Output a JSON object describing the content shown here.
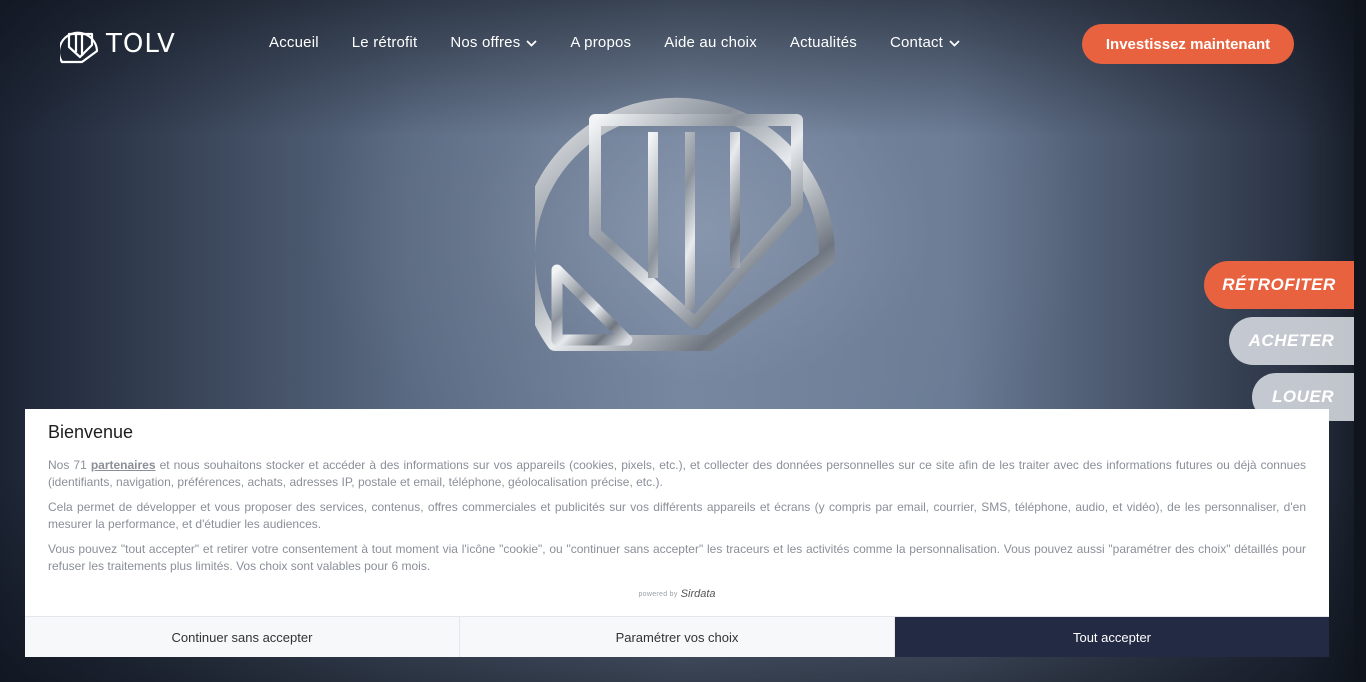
{
  "brand": {
    "name": "TOLV"
  },
  "nav": {
    "items": [
      {
        "label": "Accueil",
        "dropdown": false
      },
      {
        "label": "Le rétrofit",
        "dropdown": false
      },
      {
        "label": "Nos offres",
        "dropdown": true
      },
      {
        "label": "A propos",
        "dropdown": false
      },
      {
        "label": "Aide au choix",
        "dropdown": false
      },
      {
        "label": "Actualités",
        "dropdown": false
      },
      {
        "label": "Contact",
        "dropdown": true
      }
    ],
    "cta_label": "Investissez maintenant"
  },
  "side_tabs": {
    "retrofit": "RÉTROFITER",
    "buy": "ACHETER",
    "rent": "LOUER"
  },
  "cookie": {
    "title": "Bienvenue",
    "p1_prefix": "Nos 71 ",
    "p1_link": "partenaires",
    "p1_suffix": " et nous souhaitons stocker et accéder à des informations sur vos appareils (cookies, pixels, etc.), et collecter des données personnelles sur ce site afin de les traiter avec des informations futures ou déjà connues (identifiants, navigation, préférences, achats, adresses IP, postale et email, téléphone, géolocalisation précise, etc.).",
    "p2": "Cela permet de développer et vous proposer des services, contenus, offres commerciales et publicités sur vos différents appareils et écrans (y compris par email, courrier, SMS, téléphone, audio, et vidéo), de les personnaliser, d'en mesurer la performance, et d'étudier les audiences.",
    "p3": "Vous pouvez \"tout accepter\" et retirer votre consentement à tout moment via l'icône \"cookie\", ou \"continuer sans accepter\" les traceurs et les activités comme la personnalisation. Vous pouvez aussi \"paramétrer des choix\" détaillés pour refuser les traitements plus limités. Vos choix sont valables pour 6 mois.",
    "powered_by": "powered by",
    "powered_brand": "Sirdata",
    "buttons": {
      "continue": "Continuer sans accepter",
      "settings": "Paramétrer vos choix",
      "accept": "Tout accepter"
    }
  },
  "colors": {
    "accent": "#e8623f",
    "dark_button": "#232a44"
  },
  "icons": [
    "chevron-down-icon",
    "logo-emblem-icon"
  ]
}
